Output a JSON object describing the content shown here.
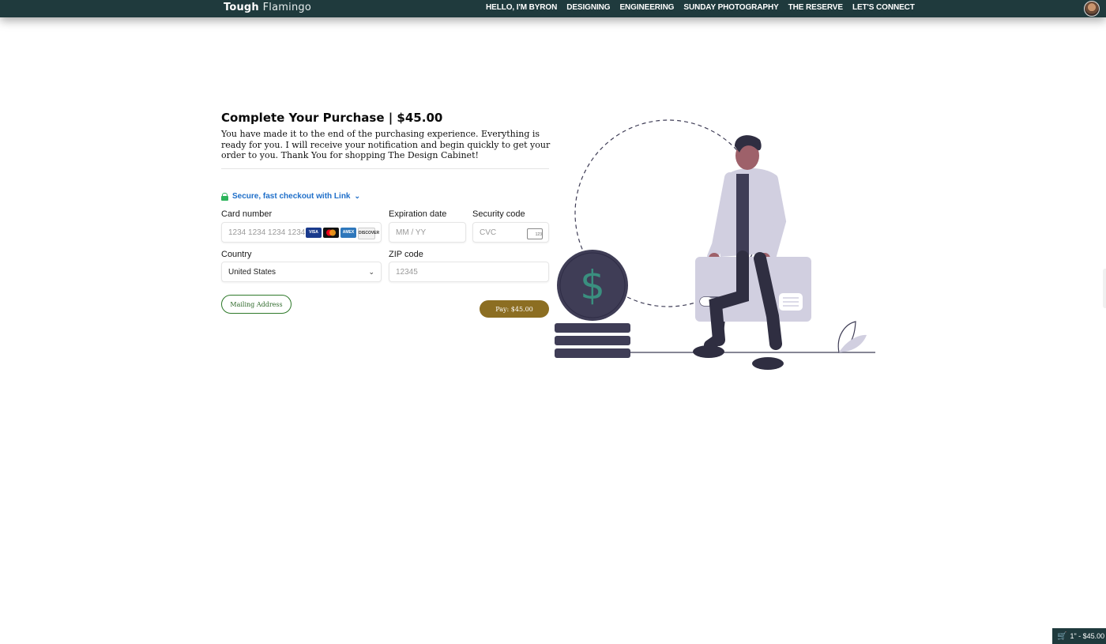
{
  "nav": {
    "brand_bold": "Tough",
    "brand_light": "Flamingo",
    "items": [
      {
        "label": "HELLO, I'M BYRON"
      },
      {
        "label": "DESIGNING"
      },
      {
        "label": "ENGINEERING"
      },
      {
        "label": "SUNDAY PHOTOGRAPHY"
      },
      {
        "label": "THE RESERVE"
      },
      {
        "label": "LET'S CONNECT"
      }
    ]
  },
  "purchase": {
    "title": "Complete Your Purchase | $45.00",
    "description": "You have made it to the end of the purchasing experience. Everything is ready for you. I will receive your notification and begin quickly to get your order to you. Thank You for shopping The Design Cabinet!"
  },
  "payment": {
    "link_text": "Secure, fast checkout with Link",
    "card_number": {
      "label": "Card number",
      "placeholder": "1234 1234 1234 1234"
    },
    "card_brands": [
      "VISA",
      "MC",
      "AMEX",
      "DISCOVER"
    ],
    "expiration": {
      "label": "Expiration date",
      "placeholder": "MM / YY"
    },
    "security": {
      "label": "Security code",
      "placeholder": "CVC",
      "icon_text": "123"
    },
    "country": {
      "label": "Country",
      "value": "United States"
    },
    "zip": {
      "label": "ZIP code",
      "placeholder": "12345"
    }
  },
  "actions": {
    "mailing_label": "Mailing Address",
    "pay_label": "Pay: $45.00"
  },
  "cart": {
    "label": "1\" - $45.00"
  },
  "colors": {
    "nav_bg": "#1f3a3d",
    "pay_button": "#8c6e22",
    "mailing_border": "#2f7a2b",
    "link_blue": "#1f6fc9",
    "coin": "#3f3d56",
    "dollar": "#3a8f7f",
    "card_lavender": "#d1cfe0"
  }
}
